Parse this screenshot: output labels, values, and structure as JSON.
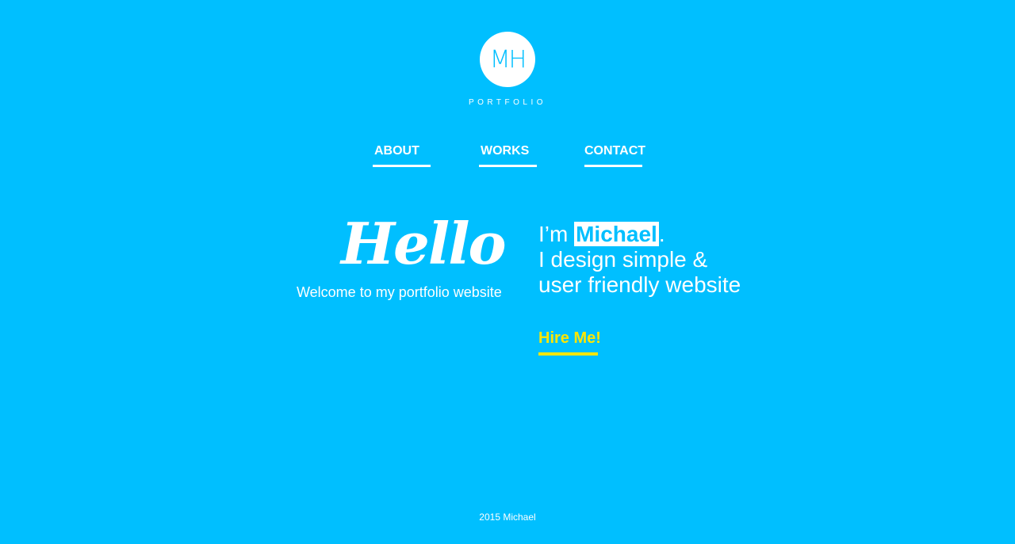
{
  "logo": {
    "initials": "MH",
    "subtitle": "PORTFOLIO"
  },
  "nav": {
    "items": [
      {
        "label": "ABOUT"
      },
      {
        "label": "WORKS"
      },
      {
        "label": "CONTACT"
      }
    ]
  },
  "hero": {
    "hello": "Hello",
    "welcome": "Welcome to my portfolio website",
    "intro_prefix": "I’m",
    "name": "Michael",
    "name_suffix": ".",
    "line2": "I design simple &",
    "line3": "user friendly website",
    "hire_label": "Hire Me!"
  },
  "footer": {
    "text": "2015 Michael"
  },
  "colors": {
    "background": "#00bfff",
    "accent": "#ffe600"
  }
}
